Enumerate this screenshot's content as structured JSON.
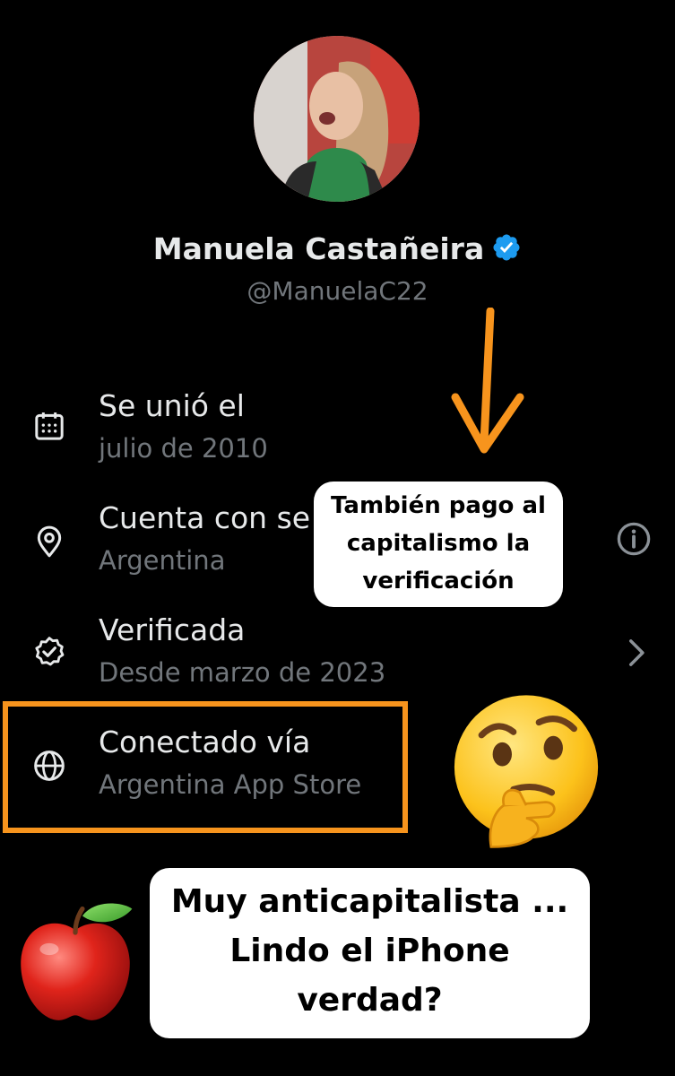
{
  "profile": {
    "name": "Manuela Castañeira",
    "handle": "@ManuelaC22",
    "verified_color": "#1d9bf0"
  },
  "details": [
    {
      "icon": "calendar-icon",
      "title": "Se unió el",
      "subtitle": "julio de 2010"
    },
    {
      "icon": "location-pin-icon",
      "title": "Cuenta con se",
      "subtitle": "Argentina",
      "right_icon": "info-icon"
    },
    {
      "icon": "verified-check-icon",
      "title": "Verificada",
      "subtitle": "Desde marzo de 2023",
      "right_icon": "chevron-right-icon"
    },
    {
      "icon": "globe-icon",
      "title": "Conectado vía",
      "subtitle": "Argentina App Store"
    }
  ],
  "annotations": {
    "callout_top": [
      "También pago al",
      "capitalismo la",
      "verificación"
    ],
    "callout_bottom": [
      "Muy anticapitalista ...",
      "Lindo el iPhone",
      "verdad?"
    ],
    "accent_color": "#f7941d",
    "emojis": [
      "thinking-face-emoji",
      "red-apple-emoji"
    ]
  }
}
